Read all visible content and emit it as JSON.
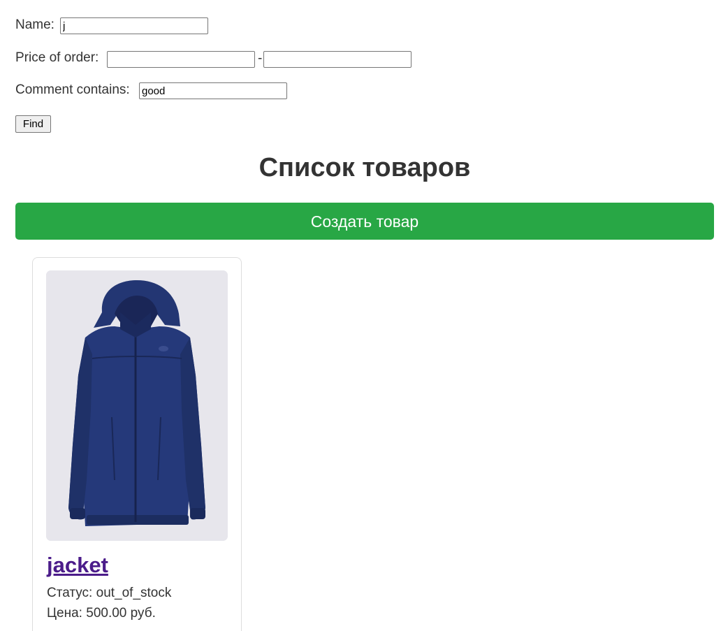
{
  "filters": {
    "name_label": "Name:",
    "name_value": "j",
    "price_label": "Price of order:",
    "price_from_value": "",
    "price_separator": "-",
    "price_to_value": "",
    "comment_label": "Comment contains:",
    "comment_value": "good",
    "find_label": "Find"
  },
  "page_title": "Список товаров",
  "create_button_label": "Создать товар",
  "colors": {
    "create_button": "#28a745",
    "product_link": "#4b1c8a",
    "image_background": "#e7e6ec"
  },
  "products": [
    {
      "name": "jacket",
      "image_icon": "navy-jacket-photo",
      "status_label": "Статус:",
      "status_value": "out_of_stock",
      "price_label": "Цена:",
      "price_value": "500.00 руб."
    }
  ]
}
